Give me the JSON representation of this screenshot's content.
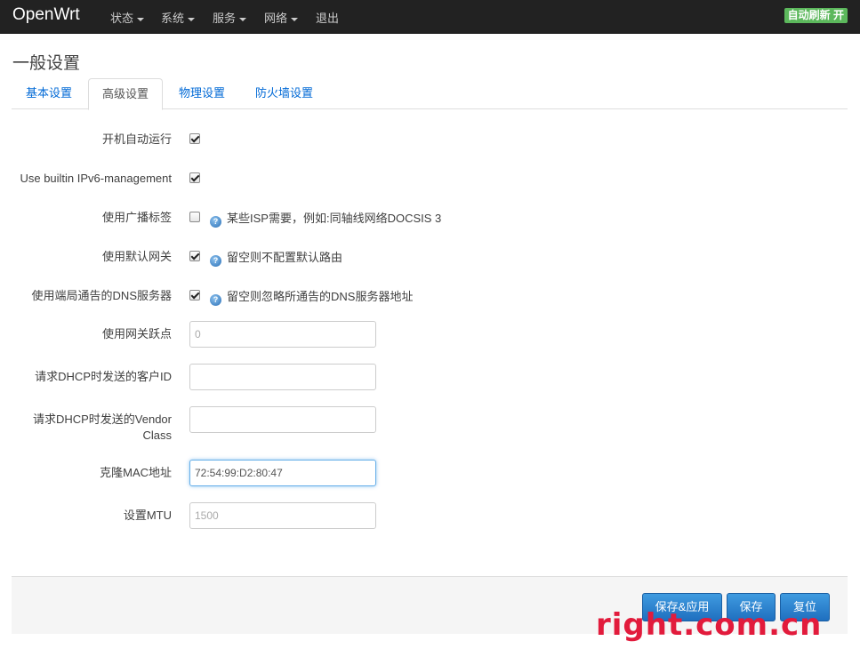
{
  "navbar": {
    "brand": "OpenWrt",
    "items": [
      {
        "label": "状态",
        "dropdown": true
      },
      {
        "label": "系统",
        "dropdown": true
      },
      {
        "label": "服务",
        "dropdown": true
      },
      {
        "label": "网络",
        "dropdown": true
      },
      {
        "label": "退出",
        "dropdown": false
      }
    ],
    "autorefresh": "自动刷新 开"
  },
  "page": {
    "title": "一般设置"
  },
  "tabs": [
    {
      "label": "基本设置",
      "active": false
    },
    {
      "label": "高级设置",
      "active": true
    },
    {
      "label": "物理设置",
      "active": false
    },
    {
      "label": "防火墙设置",
      "active": false
    }
  ],
  "form": {
    "auto_start": {
      "label": "开机自动运行",
      "checked": true
    },
    "builtin_ipv6": {
      "label": "Use builtin IPv6-management",
      "checked": true
    },
    "broadcast_flag": {
      "label": "使用广播标签",
      "checked": false,
      "hint": "某些ISP需要，例如:同轴线网络DOCSIS 3"
    },
    "default_gateway": {
      "label": "使用默认网关",
      "checked": true,
      "hint": "留空则不配置默认路由"
    },
    "peer_dns": {
      "label": "使用端局通告的DNS服务器",
      "checked": true,
      "hint": "留空则忽略所通告的DNS服务器地址"
    },
    "gateway_metric": {
      "label": "使用网关跃点",
      "placeholder": "0",
      "value": ""
    },
    "client_id": {
      "label": "请求DHCP时发送的客户ID",
      "placeholder": "",
      "value": ""
    },
    "vendor_class": {
      "label": "请求DHCP时发送的Vendor Class",
      "placeholder": "",
      "value": ""
    },
    "clone_mac": {
      "label": "克隆MAC地址",
      "placeholder": "",
      "value": "72:54:99:D2:80:47"
    },
    "mtu": {
      "label": "设置MTU",
      "placeholder": "1500",
      "value": ""
    }
  },
  "actions": {
    "save_apply": "保存&应用",
    "save": "保存",
    "reset": "复位"
  },
  "watermark": "right.com.cn",
  "colors": {
    "navbar_bg": "#222222",
    "autorefresh_bg": "#5cb85c",
    "link": "#0069d6",
    "button": "#2f86d1",
    "watermark": "#e21b3c"
  }
}
